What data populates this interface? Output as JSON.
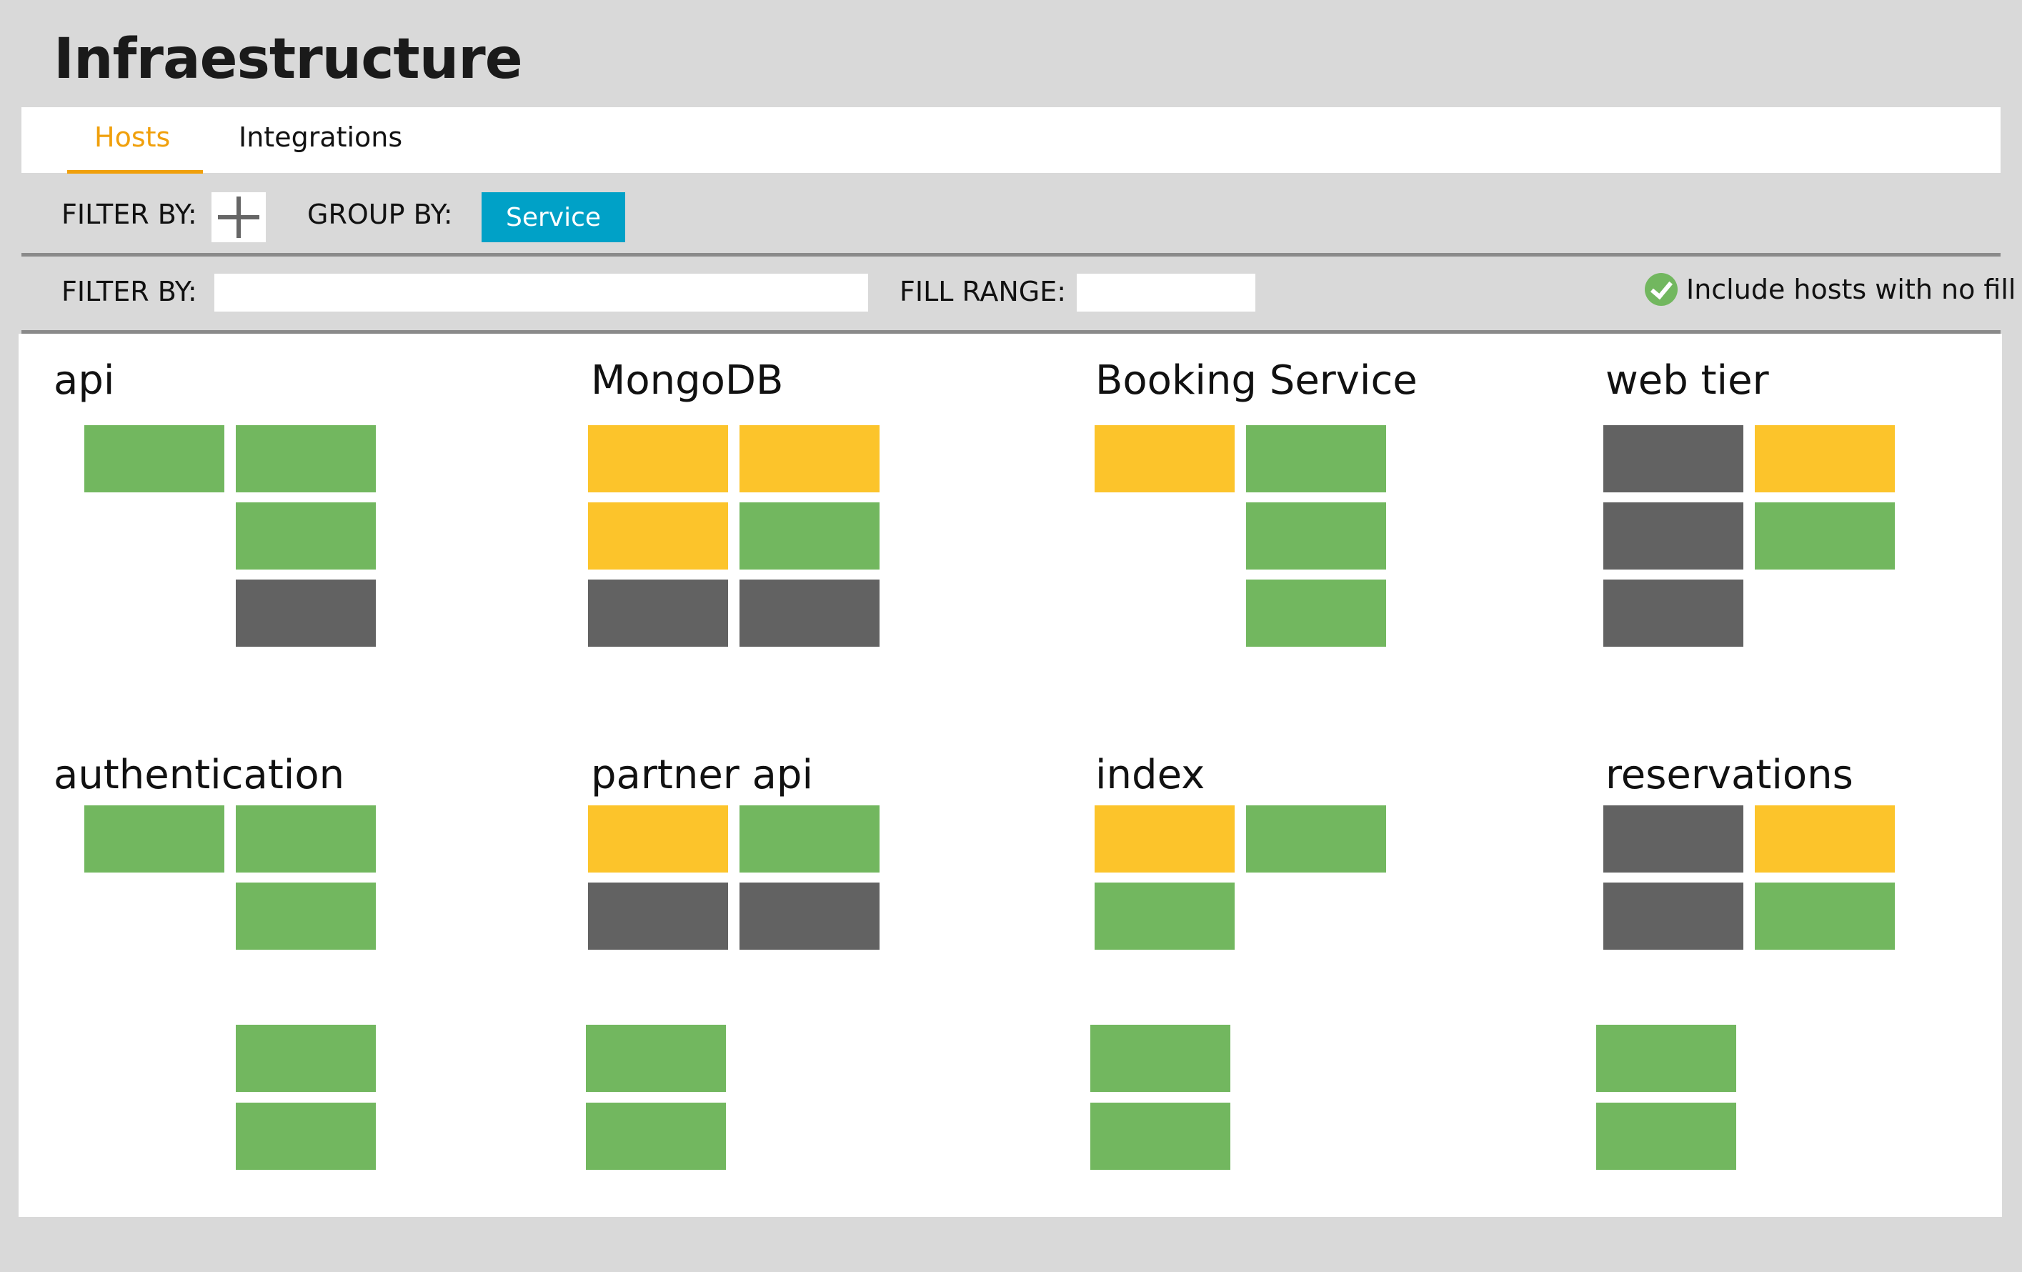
{
  "header": {
    "title": "Infraestructure"
  },
  "tabs": [
    {
      "label": "Hosts",
      "active": true
    },
    {
      "label": "Integrations",
      "active": false
    }
  ],
  "toolbar": {
    "filter_label": "FILTER BY:",
    "add_filter_icon": "plus-icon",
    "group_label": "GROUP BY:",
    "group_value": "Service"
  },
  "filters": {
    "filter_label": "FILTER BY:",
    "filter_value": "",
    "fill_range_label": "FILL RANGE:",
    "fill_range_value": "",
    "include_no_fill_label": "Include hosts with no fill",
    "include_no_fill_checked": true
  },
  "colors": {
    "ok": "#72b75f",
    "warning": "#fcc42b",
    "no_fill": "#626262",
    "accent": "#f0a00c",
    "button": "#00a1c7"
  },
  "groups": [
    {
      "name": "api",
      "hosts": [
        [
          "ok",
          "ok"
        ],
        [
          null,
          "ok"
        ],
        [
          null,
          "nodata"
        ]
      ]
    },
    {
      "name": "MongoDB",
      "hosts": [
        [
          "warn",
          "warn"
        ],
        [
          "warn",
          "ok"
        ],
        [
          "nodata",
          "nodata"
        ]
      ]
    },
    {
      "name": "Booking Service",
      "hosts": [
        [
          "warn",
          "ok"
        ],
        [
          null,
          "ok"
        ],
        [
          null,
          "ok"
        ]
      ]
    },
    {
      "name": "web tier",
      "hosts": [
        [
          "nodata",
          "warn"
        ],
        [
          "nodata",
          "ok"
        ],
        [
          "nodata",
          null
        ]
      ]
    },
    {
      "name": "authentication",
      "hosts": [
        [
          "ok",
          "ok"
        ],
        [
          null,
          "ok"
        ]
      ]
    },
    {
      "name": "partner api",
      "hosts": [
        [
          "warn",
          "ok"
        ],
        [
          "nodata",
          "nodata"
        ]
      ]
    },
    {
      "name": "index",
      "hosts": [
        [
          "warn",
          "ok"
        ],
        [
          "ok",
          null
        ]
      ]
    },
    {
      "name": "reservations",
      "hosts": [
        [
          "nodata",
          "warn"
        ],
        [
          "nodata",
          "ok"
        ]
      ]
    }
  ],
  "extra_hosts": [
    {
      "column": 0,
      "status": [
        "ok",
        "ok"
      ]
    },
    {
      "column": 1,
      "status": [
        "ok",
        "ok"
      ]
    },
    {
      "column": 2,
      "status": [
        "ok",
        "ok"
      ]
    },
    {
      "column": 3,
      "status": [
        "ok",
        "ok"
      ]
    }
  ]
}
